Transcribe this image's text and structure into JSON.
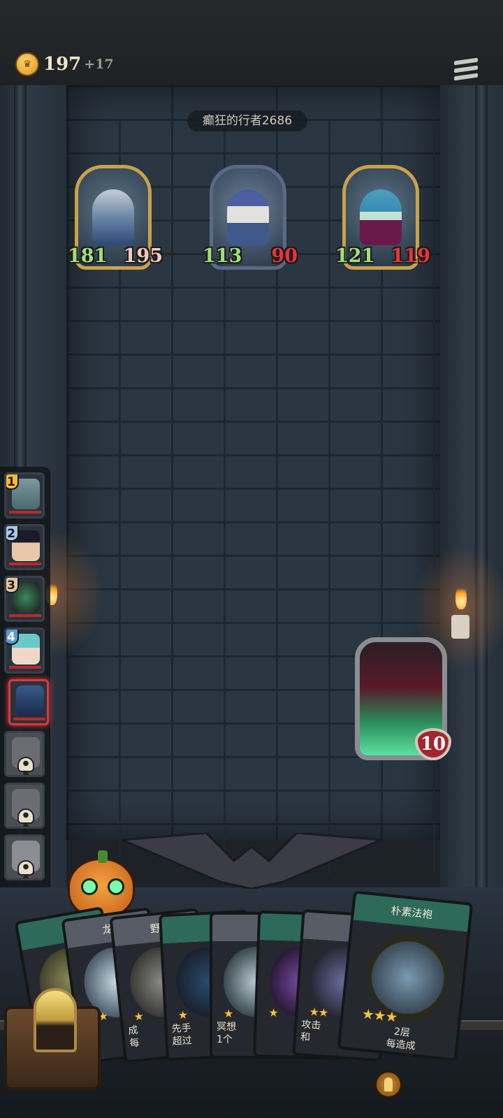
{
  "top_bar": {
    "gold_amount": "197",
    "gold_increment": "+17",
    "coin_icon": "crown-coin-icon",
    "menu_icon": "hamburger-menu-icon"
  },
  "opponent": {
    "name": "癫狂的行者2686"
  },
  "enemy_heroes": [
    {
      "portrait": "armored-knight",
      "attack": "181",
      "health": "195"
    },
    {
      "portrait": "white-haired-wizard",
      "attack": "113",
      "health": "90"
    },
    {
      "portrait": "elf-sorceress",
      "attack": "121",
      "health": "119"
    }
  ],
  "roster": [
    {
      "order": "1",
      "state": "alive"
    },
    {
      "order": "2",
      "state": "alive"
    },
    {
      "order": "3",
      "state": "alive"
    },
    {
      "order": "4",
      "state": "alive"
    },
    {
      "order": "",
      "state": "active"
    },
    {
      "order": "",
      "state": "dead"
    },
    {
      "order": "",
      "state": "dead"
    },
    {
      "order": "",
      "state": "dead"
    }
  ],
  "enemy_minion": {
    "portrait": "shadow-demon",
    "health": "10"
  },
  "hand": [
    {
      "title": "",
      "stars": "",
      "desc": ""
    },
    {
      "title": "龙",
      "stars": "★★",
      "desc": "成"
    },
    {
      "title": "野",
      "stars": "★",
      "desc": "成\n每"
    },
    {
      "title": "",
      "stars": "★",
      "desc": "先手\n超过"
    },
    {
      "title": "",
      "stars": "★",
      "desc": "冥想\n1个"
    },
    {
      "title": "",
      "stars": "★",
      "desc": ""
    },
    {
      "title": "",
      "stars": "★★",
      "desc": "攻击\n和"
    },
    {
      "title": "朴素法袍",
      "stars": "★★★",
      "desc": "2层\n每造成"
    }
  ],
  "colors": {
    "attack_green": "#9fe07a",
    "health_red": "#e9343a",
    "gold_frame": "#c9a24a",
    "active_slot": "#d73a3a"
  }
}
